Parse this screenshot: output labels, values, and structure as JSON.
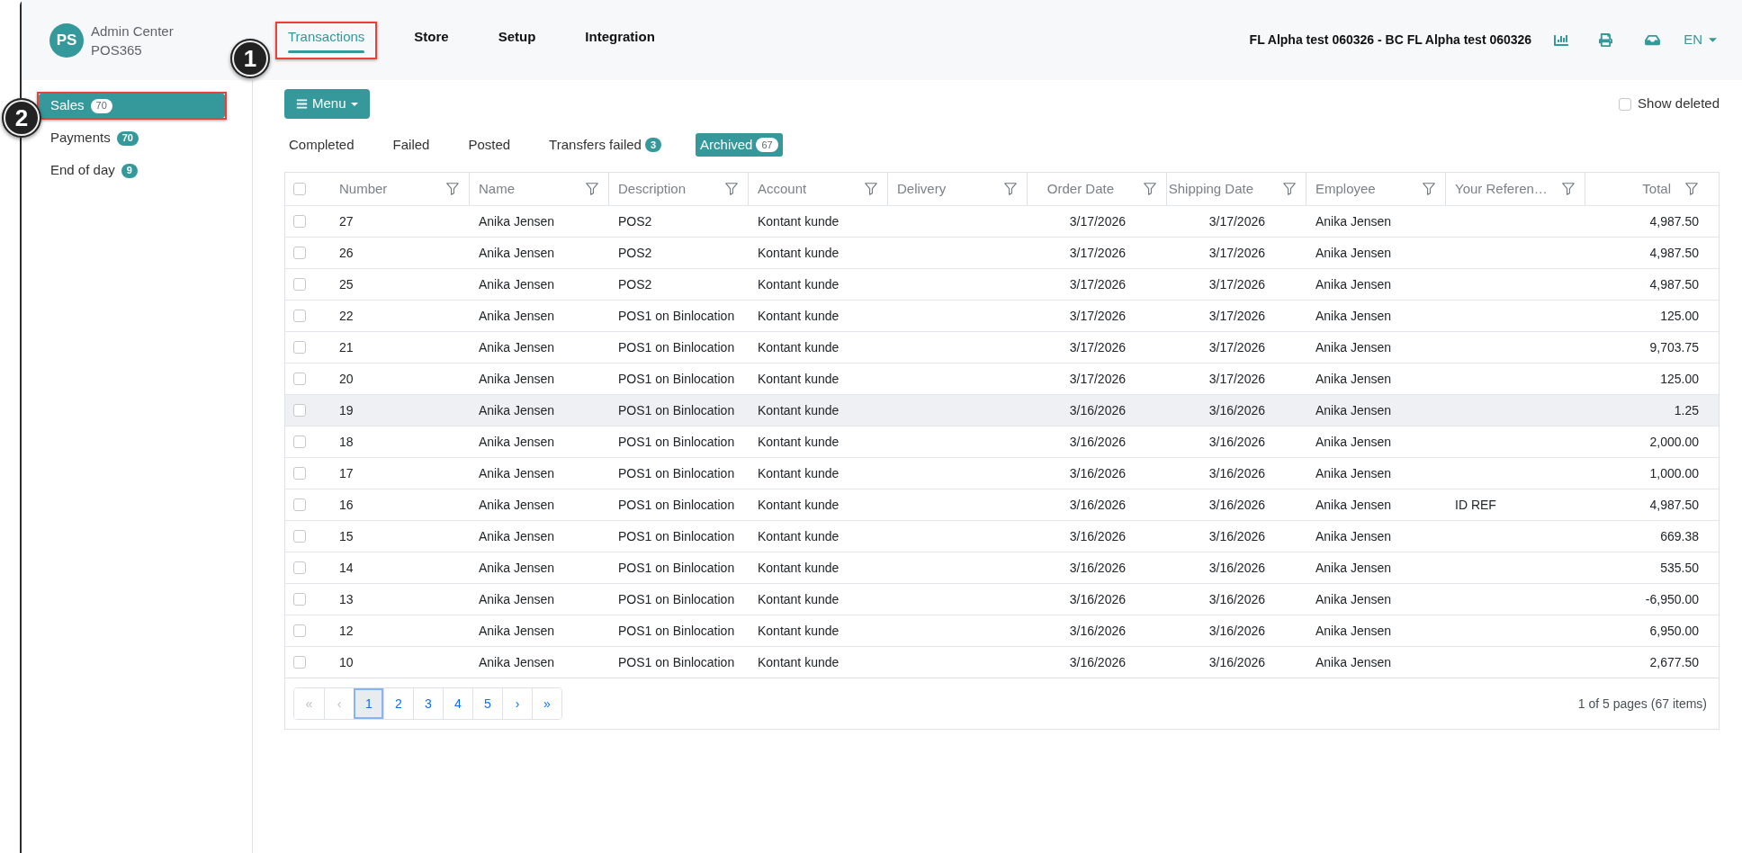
{
  "header": {
    "avatar": "PS",
    "title": "Admin Center",
    "subtitle": "POS365",
    "nav": [
      {
        "label": "Transactions",
        "selected": true,
        "outlined": true
      },
      {
        "label": "Store",
        "selected": false,
        "outlined": false
      },
      {
        "label": "Setup",
        "selected": false,
        "outlined": false
      },
      {
        "label": "Integration",
        "selected": false,
        "outlined": false
      }
    ],
    "company": "FL Alpha test 060326 - BC FL Alpha test 060326",
    "language": "EN"
  },
  "sidebar": {
    "items": [
      {
        "label": "Sales",
        "count": "70",
        "selected": true,
        "outlined": true
      },
      {
        "label": "Payments",
        "count": "70",
        "selected": false,
        "outlined": false
      },
      {
        "label": "End of day",
        "count": "9",
        "selected": false,
        "outlined": false
      }
    ]
  },
  "toolbar": {
    "menu_button": "Menu",
    "show_deleted": {
      "label": "Show deleted",
      "checked": false
    }
  },
  "status_tabs": [
    {
      "label": "Completed",
      "selected": false
    },
    {
      "label": "Failed",
      "selected": false
    },
    {
      "label": "Posted",
      "selected": false
    },
    {
      "label": "Transfers failed",
      "count": "3",
      "selected": false
    },
    {
      "label": "Archived",
      "count": "67",
      "selected": true
    }
  ],
  "table": {
    "select_all_checked": false,
    "columns": [
      {
        "label": "Number",
        "kind": "text"
      },
      {
        "label": "Name",
        "kind": "text"
      },
      {
        "label": "Description",
        "kind": "text"
      },
      {
        "label": "Account",
        "kind": "text"
      },
      {
        "label": "Delivery",
        "kind": "text"
      },
      {
        "label": "Order Date",
        "kind": "date"
      },
      {
        "label": "Shipping Date",
        "kind": "date"
      },
      {
        "label": "Employee",
        "kind": "text"
      },
      {
        "label": "Your Referen…",
        "kind": "text"
      },
      {
        "label": "Total",
        "kind": "amount"
      }
    ],
    "rows": [
      {
        "checked": false,
        "hovered": false,
        "number": "27",
        "name": "Anika Jensen",
        "description": "POS2",
        "account": "Kontant kunde",
        "order_date": "3/17/2026",
        "shipping_date": "3/17/2026",
        "employee": "Anika Jensen",
        "total": "4,987.50"
      },
      {
        "checked": false,
        "hovered": false,
        "number": "26",
        "name": "Anika Jensen",
        "description": "POS2",
        "account": "Kontant kunde",
        "order_date": "3/17/2026",
        "shipping_date": "3/17/2026",
        "employee": "Anika Jensen",
        "total": "4,987.50"
      },
      {
        "checked": false,
        "hovered": false,
        "number": "25",
        "name": "Anika Jensen",
        "description": "POS2",
        "account": "Kontant kunde",
        "order_date": "3/17/2026",
        "shipping_date": "3/17/2026",
        "employee": "Anika Jensen",
        "total": "4,987.50"
      },
      {
        "checked": false,
        "hovered": false,
        "number": "22",
        "name": "Anika Jensen",
        "description": "POS1 on Binlocation",
        "account": "Kontant kunde",
        "order_date": "3/17/2026",
        "shipping_date": "3/17/2026",
        "employee": "Anika Jensen",
        "total": "125.00"
      },
      {
        "checked": false,
        "hovered": false,
        "number": "21",
        "name": "Anika Jensen",
        "description": "POS1 on Binlocation",
        "account": "Kontant kunde",
        "order_date": "3/17/2026",
        "shipping_date": "3/17/2026",
        "employee": "Anika Jensen",
        "total": "9,703.75"
      },
      {
        "checked": false,
        "hovered": false,
        "number": "20",
        "name": "Anika Jensen",
        "description": "POS1 on Binlocation",
        "account": "Kontant kunde",
        "order_date": "3/17/2026",
        "shipping_date": "3/17/2026",
        "employee": "Anika Jensen",
        "total": "125.00"
      },
      {
        "checked": false,
        "hovered": true,
        "number": "19",
        "name": "Anika Jensen",
        "description": "POS1 on Binlocation",
        "account": "Kontant kunde",
        "order_date": "3/16/2026",
        "shipping_date": "3/16/2026",
        "employee": "Anika Jensen",
        "total": "1.25"
      },
      {
        "checked": false,
        "hovered": false,
        "number": "18",
        "name": "Anika Jensen",
        "description": "POS1 on Binlocation",
        "account": "Kontant kunde",
        "order_date": "3/16/2026",
        "shipping_date": "3/16/2026",
        "employee": "Anika Jensen",
        "total": "2,000.00"
      },
      {
        "checked": false,
        "hovered": false,
        "number": "17",
        "name": "Anika Jensen",
        "description": "POS1 on Binlocation",
        "account": "Kontant kunde",
        "order_date": "3/16/2026",
        "shipping_date": "3/16/2026",
        "employee": "Anika Jensen",
        "total": "1,000.00"
      },
      {
        "checked": false,
        "hovered": false,
        "number": "16",
        "name": "Anika Jensen",
        "description": "POS1 on Binlocation",
        "account": "Kontant kunde",
        "order_date": "3/16/2026",
        "shipping_date": "3/16/2026",
        "employee": "Anika Jensen",
        "your_reference": "ID REF",
        "total": "4,987.50"
      },
      {
        "checked": false,
        "hovered": false,
        "number": "15",
        "name": "Anika Jensen",
        "description": "POS1 on Binlocation",
        "account": "Kontant kunde",
        "order_date": "3/16/2026",
        "shipping_date": "3/16/2026",
        "employee": "Anika Jensen",
        "total": "669.38"
      },
      {
        "checked": false,
        "hovered": false,
        "number": "14",
        "name": "Anika Jensen",
        "description": "POS1 on Binlocation",
        "account": "Kontant kunde",
        "order_date": "3/16/2026",
        "shipping_date": "3/16/2026",
        "employee": "Anika Jensen",
        "total": "535.50"
      },
      {
        "checked": false,
        "hovered": false,
        "number": "13",
        "name": "Anika Jensen",
        "description": "POS1 on Binlocation",
        "account": "Kontant kunde",
        "order_date": "3/16/2026",
        "shipping_date": "3/16/2026",
        "employee": "Anika Jensen",
        "total": "-6,950.00"
      },
      {
        "checked": false,
        "hovered": false,
        "number": "12",
        "name": "Anika Jensen",
        "description": "POS1 on Binlocation",
        "account": "Kontant kunde",
        "order_date": "3/16/2026",
        "shipping_date": "3/16/2026",
        "employee": "Anika Jensen",
        "total": "6,950.00"
      },
      {
        "checked": false,
        "hovered": false,
        "number": "10",
        "name": "Anika Jensen",
        "description": "POS1 on Binlocation",
        "account": "Kontant kunde",
        "order_date": "3/16/2026",
        "shipping_date": "3/16/2026",
        "employee": "Anika Jensen",
        "total": "2,677.50"
      }
    ]
  },
  "pagination": {
    "pages": [
      {
        "label": "«",
        "selected": false,
        "disabled": true
      },
      {
        "label": "‹",
        "selected": false,
        "disabled": true
      },
      {
        "label": "1",
        "selected": true,
        "disabled": false
      },
      {
        "label": "2",
        "selected": false,
        "disabled": false
      },
      {
        "label": "3",
        "selected": false,
        "disabled": false
      },
      {
        "label": "4",
        "selected": false,
        "disabled": false
      },
      {
        "label": "5",
        "selected": false,
        "disabled": false
      },
      {
        "label": "›",
        "selected": false,
        "disabled": false
      },
      {
        "label": "»",
        "selected": false,
        "disabled": false
      }
    ],
    "summary": "1 of 5 pages (67 items)"
  },
  "markers": [
    {
      "label": "1"
    },
    {
      "label": "2"
    }
  ]
}
